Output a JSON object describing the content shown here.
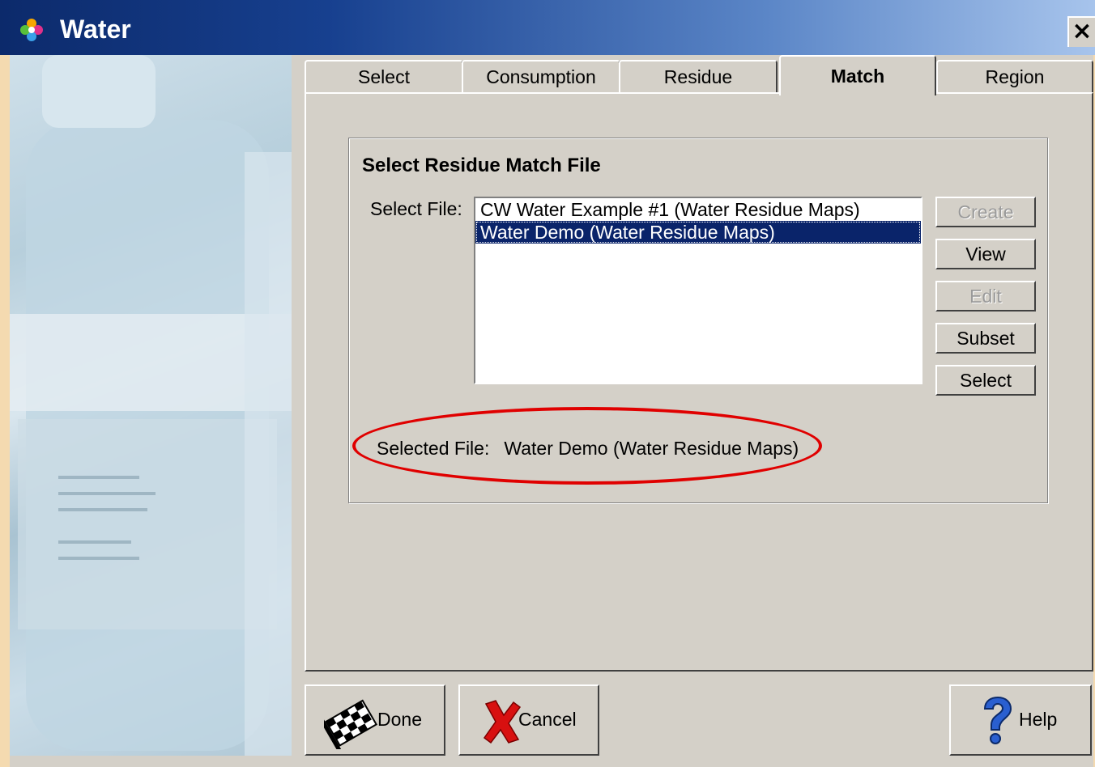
{
  "window": {
    "title": "Water",
    "close_label": "×"
  },
  "tabs": [
    {
      "label": "Select"
    },
    {
      "label": "Consumption"
    },
    {
      "label": "Residue"
    },
    {
      "label": "Match",
      "active": true
    },
    {
      "label": "Region"
    }
  ],
  "panel": {
    "group_title": "Select Residue Match File",
    "select_file_label": "Select File:",
    "files": [
      {
        "label": "CW Water Example #1 (Water Residue Maps)",
        "selected": false
      },
      {
        "label": "Water Demo (Water Residue Maps)",
        "selected": true
      }
    ],
    "buttons": {
      "create": "Create",
      "view": "View",
      "edit": "Edit",
      "subset": "Subset",
      "select": "Select"
    },
    "selected_file_label": "Selected File:",
    "selected_file_value": "Water Demo (Water Residue Maps)",
    "highlight_color": "#e00000"
  },
  "footer": {
    "done": "Done",
    "cancel": "Cancel",
    "help": "Help"
  },
  "icons": [
    "flower-icon",
    "checkered-flag-icon",
    "red-x-icon",
    "question-mark-icon",
    "close-icon"
  ]
}
